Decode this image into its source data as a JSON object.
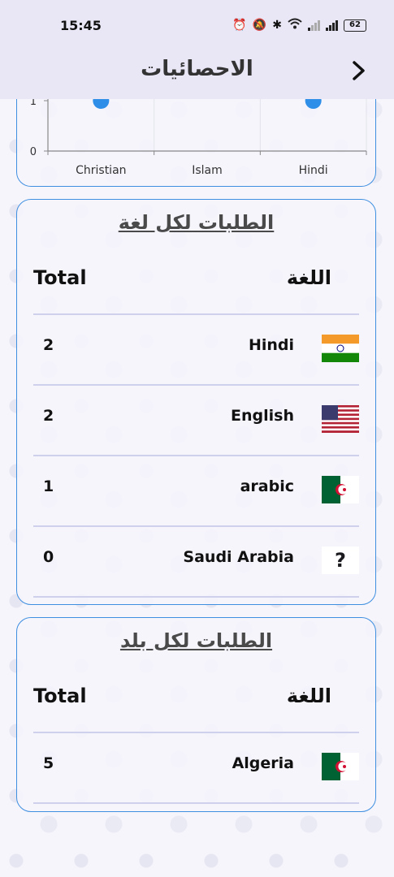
{
  "status_bar": {
    "time": "15:45",
    "battery": "62",
    "icons": [
      "alarm-icon",
      "mute-icon",
      "bluetooth-icon",
      "wifi-icon",
      "signal-icon",
      "signal-icon",
      "battery-icon"
    ]
  },
  "app_bar": {
    "title": "الاحصائيات",
    "back_icon": "chevron-right-icon"
  },
  "chart_data": {
    "type": "line",
    "categories": [
      "Christian",
      "Islam",
      "Hindi"
    ],
    "y_tick_labels": [
      "0",
      "1"
    ],
    "visible_points": [
      {
        "category": "Christian",
        "value": 1
      },
      {
        "category": "Hindi",
        "value": 1
      }
    ],
    "point_color": "#2f8fe8"
  },
  "language_card": {
    "title": "الطلبات لكل لغة",
    "header_total": "Total",
    "header_name": "اللغة",
    "rows": [
      {
        "total": "2",
        "name": "Hindi",
        "flag": "india-flag"
      },
      {
        "total": "2",
        "name": "English",
        "flag": "usa-flag"
      },
      {
        "total": "1",
        "name": "arabic",
        "flag": "algeria-flag"
      },
      {
        "total": "0",
        "name": "Saudi Arabia",
        "flag": "?"
      }
    ]
  },
  "country_card": {
    "title": "الطلبات لكل بلد",
    "header_total": "Total",
    "header_name": "اللغة",
    "rows": [
      {
        "total": "5",
        "name": "Algeria",
        "flag": "algeria-flag"
      }
    ]
  },
  "colors": {
    "card_border": "#3f8fe0",
    "divider": "#cfd0ec",
    "app_bar_bg": "#e9e7f5"
  }
}
